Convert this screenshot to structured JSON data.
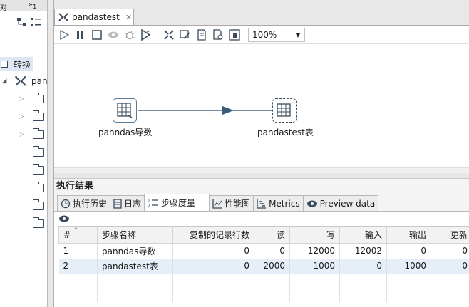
{
  "left_pane": {
    "tab_label": "对",
    "overflow_label": "»",
    "overflow_count": "1",
    "tree_root_label": "转换",
    "tree_item_label": "pan"
  },
  "editor": {
    "tab_title": "pandastest",
    "zoom": "100%"
  },
  "canvas": {
    "steps": [
      {
        "label": "panndas导数"
      },
      {
        "label": "pandastest表"
      }
    ]
  },
  "results": {
    "title": "执行结果",
    "tabs": [
      {
        "label": "执行历史",
        "icon": "history-icon"
      },
      {
        "label": "日志",
        "icon": "log-icon"
      },
      {
        "label": "步骤度量",
        "icon": "metrics-icon"
      },
      {
        "label": "性能图",
        "icon": "chart-icon"
      },
      {
        "label": "Metrics",
        "icon": "gantt-icon"
      },
      {
        "label": "Preview data",
        "icon": "eye-icon"
      }
    ],
    "columns": [
      "#",
      "步骤名称",
      "复制的记录行数",
      "读",
      "写",
      "输入",
      "输出",
      "更新"
    ],
    "rows": [
      [
        "1",
        "panndas导数",
        "0",
        "0",
        "12000",
        "12002",
        "0",
        "0"
      ],
      [
        "2",
        "pandastest表",
        "0",
        "2000",
        "1000",
        "0",
        "1000",
        "0"
      ]
    ]
  }
}
